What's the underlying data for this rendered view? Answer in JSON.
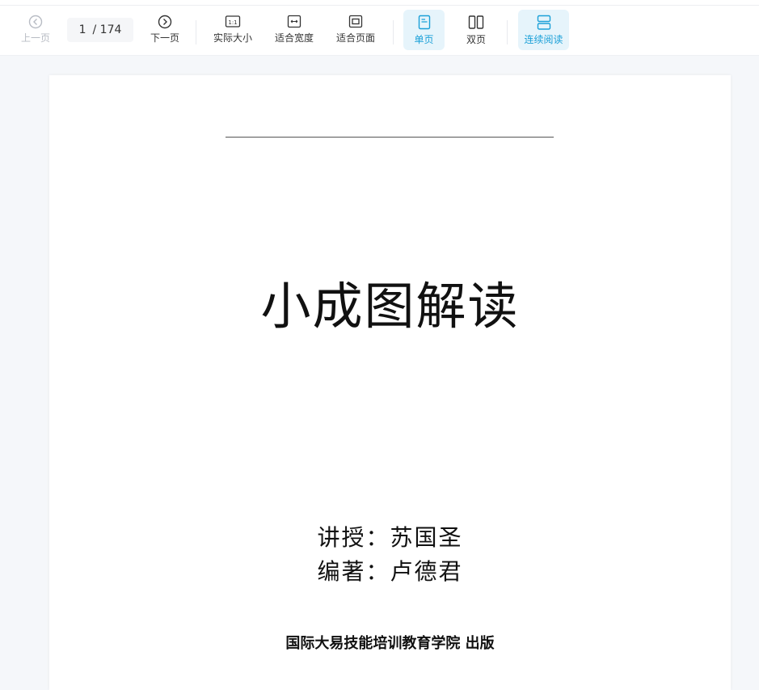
{
  "toolbar": {
    "prev_label": "上一页",
    "next_label": "下一页",
    "page_current": "1",
    "page_total": "/ 174",
    "actual_size_label": "实际大小",
    "actual_size_icon_text": "1:1",
    "fit_width_label": "适合宽度",
    "fit_page_label": "适合页面",
    "single_page_label": "单页",
    "double_page_label": "双页",
    "continuous_label": "连续阅读"
  },
  "colors": {
    "accent": "#1ba0d8",
    "active_bg": "#e6f4fb",
    "disabled": "#b8bcc4"
  },
  "icons": {
    "prev": "chevron-left-circle-icon",
    "next": "chevron-right-circle-icon",
    "actual_size": "actual-size-icon",
    "fit_width": "fit-width-icon",
    "fit_page": "fit-page-icon",
    "single_page": "single-page-icon",
    "double_page": "double-page-icon",
    "continuous": "continuous-read-icon"
  },
  "document": {
    "title": "小成图解读",
    "lecturer_line": "讲授：苏国圣",
    "editor_line": "编著：卢德君",
    "publisher_line": "国际大易技能培训教育学院  出版"
  }
}
